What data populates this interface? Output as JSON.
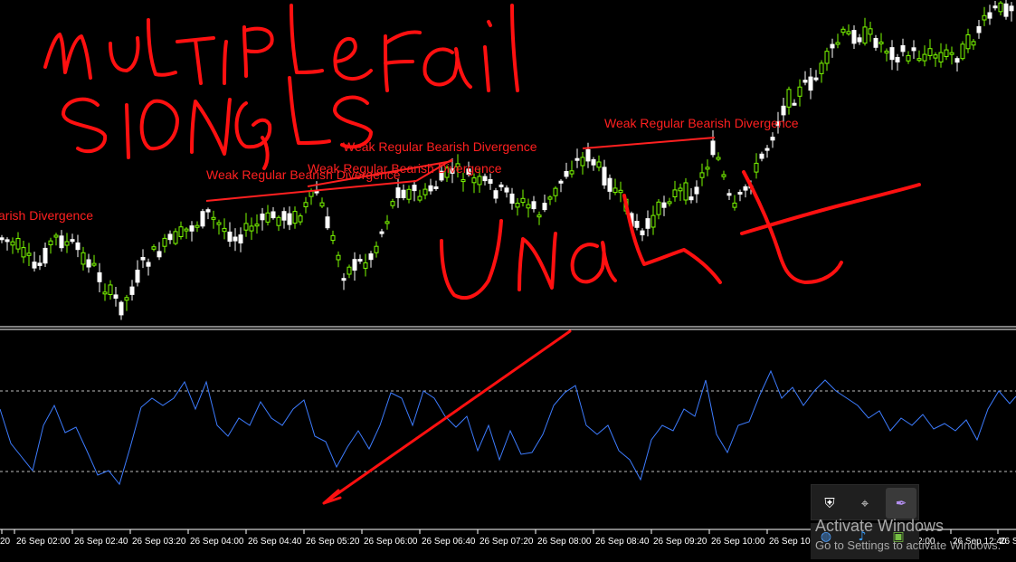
{
  "chart_data": [
    {
      "type": "candlestick",
      "colors": {
        "bull": "#7cfc00",
        "bull_body": "#000000",
        "bear": "#ffffff",
        "bear_body": "#ffffff",
        "background": "#000000"
      },
      "grid": false,
      "annotations": [
        {
          "text": "arish Divergence",
          "color": "#ff2020"
        },
        {
          "text": "Weak Regular Bearish Divergence",
          "color": "#ff2020"
        },
        {
          "text": "Weak Regular Bearish Divergence",
          "color": "#ff2020"
        },
        {
          "text": "Weak Regular Bearish Divergence",
          "color": "#ff2020"
        },
        {
          "text": "Weak Regular Bearish Divergence",
          "color": "#ff2020"
        }
      ],
      "handwriting": [
        {
          "text": "MULTIPLE SIGNALS Fail",
          "color": "#ff1010"
        },
        {
          "text": "Una",
          "color": "#ff1010"
        }
      ]
    },
    {
      "type": "line",
      "series": [
        {
          "color": "#3d7cff"
        }
      ],
      "reference_lines": [
        "dashed-upper",
        "dashed-lower"
      ],
      "grid": false
    }
  ],
  "time_axis": {
    "labels": [
      "20",
      "26 Sep 02:00",
      "26 Sep 02:40",
      "26 Sep 03:20",
      "26 Sep 04:00",
      "26 Sep 04:40",
      "26 Sep 05:20",
      "26 Sep 06:00",
      "26 Sep 06:40",
      "26 Sep 07:20",
      "26 Sep 08:00",
      "26 Sep 08:40",
      "26 Sep 09:20",
      "26 Sep 10:00",
      "26 Sep 10:",
      "2:00",
      "26 Sep 12:40",
      "26 S"
    ]
  },
  "tray": {
    "icons": [
      "shield-warning-icon",
      "mouse-icon",
      "feather-icon",
      "globe-icon",
      "audio-icon",
      "gpu-icon"
    ]
  },
  "watermark": {
    "title": "Activate Windows",
    "subtitle": "Go to Settings to activate Windows."
  }
}
